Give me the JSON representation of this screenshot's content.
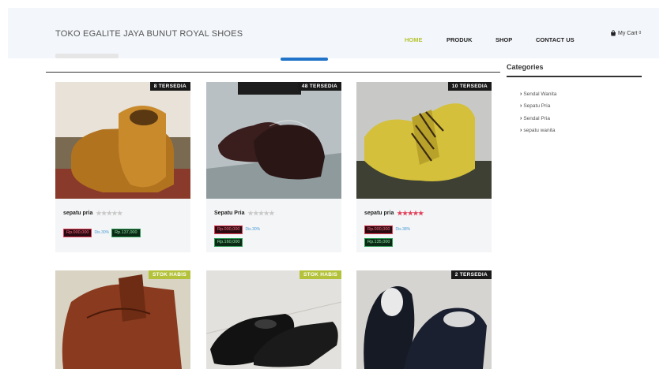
{
  "header": {
    "brand": "TOKO EGALITE JAYA BUNUT ROYAL SHOES",
    "nav": [
      {
        "label": "HOME",
        "active": true
      },
      {
        "label": "PRODUK",
        "active": false
      },
      {
        "label": "SHOP",
        "active": false
      },
      {
        "label": "CONTACT US",
        "active": false
      }
    ],
    "cart_label": "My Cart",
    "cart_count": "0"
  },
  "sidebar": {
    "title": "Categories",
    "items": [
      "Sendal Wanita",
      "Sepatu Pria",
      "Sendal Pria",
      "sepatu wanita"
    ]
  },
  "products": [
    {
      "name": "sepatu pria",
      "badge": "8 TERSEDIA",
      "stars_rating": 0,
      "price_old": "Rp.000,000",
      "discount": "Dis.30%",
      "price_new": "Rp.137,000"
    },
    {
      "name": "Sepatu Pria",
      "badge": "48 TERSEDIA",
      "stars_rating": 0,
      "price_old": "Rp.000,000",
      "discount": "Dis.30%",
      "price_new": "Rp.160,000"
    },
    {
      "name": "sepatu pria",
      "badge": "10 TERSEDIA",
      "stars_rating": 5,
      "price_old": "Rp.000,000",
      "discount": "Dis.38%",
      "price_new": "Rp.135,000"
    },
    {
      "name": "",
      "badge": "STOK HABIS",
      "stars_rating": 0,
      "price_old": "",
      "discount": "",
      "price_new": ""
    },
    {
      "name": "",
      "badge": "STOK HABIS",
      "stars_rating": 0,
      "price_old": "",
      "discount": "",
      "price_new": ""
    },
    {
      "name": "",
      "badge": "2 TERSEDIA",
      "stars_rating": 0,
      "price_old": "",
      "discount": "",
      "price_new": ""
    }
  ],
  "colors": {
    "accent_active_nav": "#b5c433",
    "tab_indicator": "#1f73c8",
    "badge_dark": "#1a1a1a",
    "badge_lime": "#b3c23a",
    "price_old": "#e23b55",
    "price_new": "#2f9a55"
  }
}
